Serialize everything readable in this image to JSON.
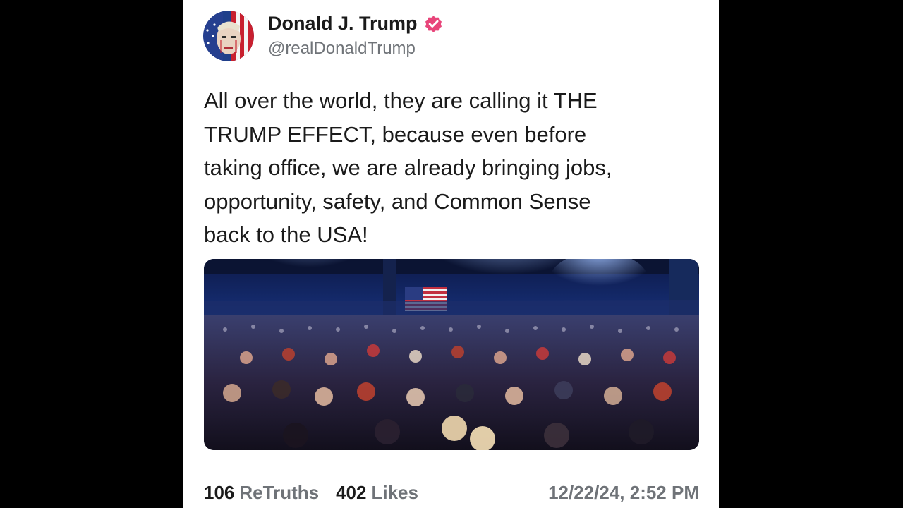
{
  "author": {
    "display_name": "Donald J. Trump",
    "handle": "@realDonaldTrump",
    "verified": true,
    "verified_color": "#e8457a"
  },
  "post": {
    "text": "All over the world, they are calling it THE\nTRUMP EFFECT, because even before\ntaking office, we are already bringing jobs,\nopportunity, safety, and Common Sense\nback to the USA!",
    "media_description": "Rally crowd in an arena with an American flag"
  },
  "stats": {
    "retruths_count": "106",
    "retruths_label": "ReTruths",
    "likes_count": "402",
    "likes_label": "Likes",
    "timestamp": "12/22/24, 2:52 PM"
  },
  "icons": {
    "avatar": "flag-portrait-avatar",
    "verified": "verified-badge-icon"
  }
}
